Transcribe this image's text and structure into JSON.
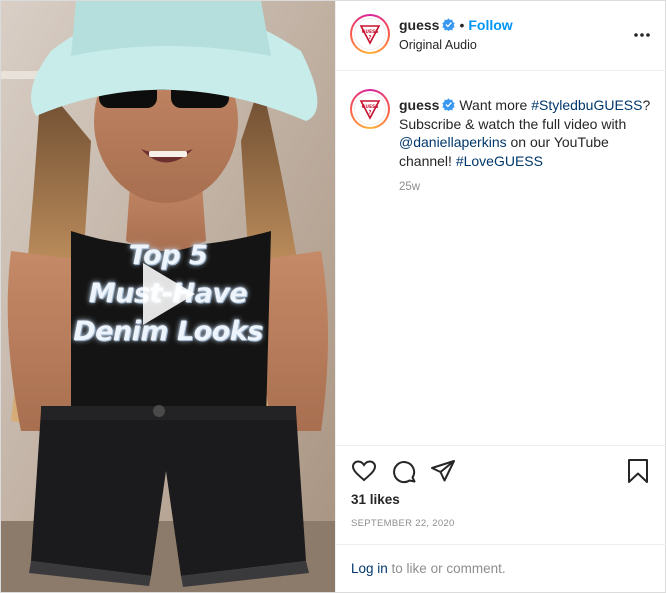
{
  "post": {
    "overlay_lines": [
      "Top 5",
      "Must-Have",
      "Denim Looks"
    ],
    "account": {
      "username": "guess",
      "verified": true,
      "separator": "•",
      "follow_label": "Follow",
      "audio_label": "Original Audio",
      "logo_text": "GUESS"
    },
    "caption": {
      "username": "guess",
      "text_before": "Want more ",
      "hashtag_1": "#StyledbuGUESS",
      "text_middle": "? Subscribe & watch the full video with ",
      "mention": "@daniellaperkins",
      "text_after": " on our YouTube channel! ",
      "hashtag_2": "#LoveGUESS",
      "age": "25w"
    },
    "likes": "31 likes",
    "date": "SEPTEMBER 22, 2020",
    "login": {
      "link_label": "Log in",
      "rest": " to like or comment."
    },
    "icons": {
      "like": "heart-icon",
      "comment": "comment-icon",
      "share": "share-icon",
      "save": "bookmark-icon",
      "more": "more-options-icon",
      "play": "play-icon",
      "verified": "verified-badge-icon"
    },
    "colors": {
      "link_blue": "#0095f6",
      "hashtag": "#00376b",
      "muted": "#8e8e8e",
      "text": "#262626"
    }
  }
}
